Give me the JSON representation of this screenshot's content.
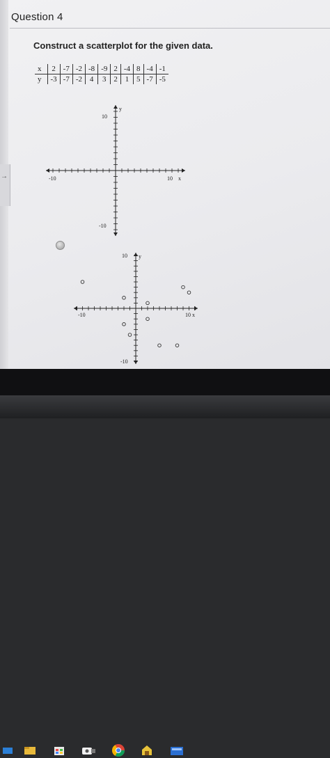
{
  "question": {
    "title": "Question 4",
    "prompt": "Construct a scatterplot for the given data."
  },
  "table": {
    "x_label": "x",
    "y_label": "y",
    "x_values": [
      "2",
      "-7",
      "-2",
      "-8",
      "-9",
      "2",
      "-4",
      "8",
      "-4",
      "-1"
    ],
    "y_values": [
      "-3",
      "-7",
      "-2",
      "4",
      "3",
      "2",
      "1",
      "5",
      "-7",
      "-5"
    ]
  },
  "axes_blank": {
    "x_axis_name": "x",
    "y_axis_name": "y",
    "x_min_label": "-10",
    "x_max_label": "10",
    "y_max_label": "10",
    "y_min_label": "-10"
  },
  "chart_data": {
    "type": "scatter",
    "x_axis_label": "x",
    "y_axis_label": "y",
    "xlim": [
      -10,
      10
    ],
    "ylim": [
      -10,
      10
    ],
    "tick_labels": {
      "x": [
        "-10",
        "10"
      ],
      "y": [
        "10",
        "-10"
      ]
    },
    "grid": false,
    "points": [
      {
        "x": -9,
        "y": 5
      },
      {
        "x": -2,
        "y": 2
      },
      {
        "x": -2,
        "y": -3
      },
      {
        "x": -1,
        "y": -5
      },
      {
        "x": 2,
        "y": 1
      },
      {
        "x": 2,
        "y": -2
      },
      {
        "x": 4,
        "y": -7
      },
      {
        "x": 7,
        "y": -7
      },
      {
        "x": 8,
        "y": 4
      },
      {
        "x": 9,
        "y": 3
      }
    ]
  },
  "taskbar": {
    "icons": [
      "start-icon",
      "file-explorer-icon",
      "store-icon",
      "camera-icon",
      "chrome-icon",
      "security-icon",
      "app-icon"
    ]
  },
  "colors": {
    "ink": "#222222",
    "screen_bg": "#ececef",
    "taskbar_bg": "#101012"
  }
}
